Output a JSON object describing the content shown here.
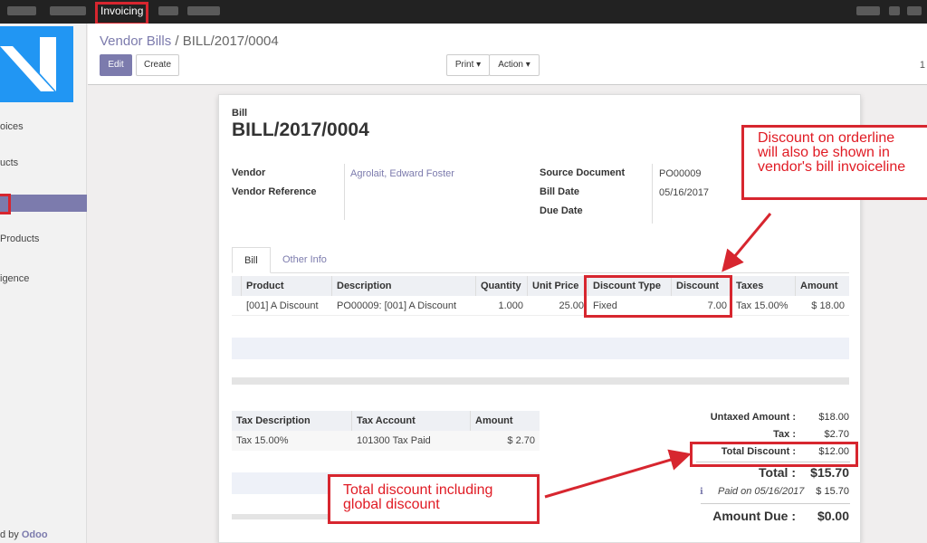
{
  "topbar": {
    "app": "Invoicing"
  },
  "sidebar": {
    "items": [
      "oices",
      "ucts",
      "Products",
      "igence"
    ],
    "powered_prefix": "d by",
    "powered_brand": "Odoo"
  },
  "breadcrumb": {
    "parent": "Vendor Bills",
    "separator": "/",
    "current": "BILL/2017/0004"
  },
  "buttons": {
    "edit": "Edit",
    "create": "Create",
    "print": "Print",
    "action": "Action"
  },
  "pager": "1",
  "bill": {
    "type_label": "Bill",
    "number": "BILL/2017/0004",
    "vendor_label": "Vendor",
    "vendor": "Agrolait, Edward Foster",
    "vendor_ref_label": "Vendor Reference",
    "source_label": "Source Document",
    "source": "PO00009",
    "bill_date_label": "Bill Date",
    "bill_date": "05/16/2017",
    "due_date_label": "Due Date"
  },
  "tabs": [
    "Bill",
    "Other Info"
  ],
  "lines": {
    "headers": [
      "Product",
      "Description",
      "Quantity",
      "Unit Price",
      "Discount Type",
      "Discount",
      "Taxes",
      "Amount"
    ],
    "row": [
      "[001] A Discount",
      "PO00009: [001] A Discount",
      "1.000",
      "25.00",
      "Fixed",
      "7.00",
      "Tax 15.00%",
      "$ 18.00"
    ]
  },
  "tax_table": {
    "headers": [
      "Tax Description",
      "Tax Account",
      "Amount"
    ],
    "row": [
      "Tax 15.00%",
      "101300 Tax Paid",
      "$ 2.70"
    ]
  },
  "totals": {
    "untaxed_label": "Untaxed Amount :",
    "untaxed": "$18.00",
    "tax_label": "Tax :",
    "tax": "$2.70",
    "discount_label": "Total Discount :",
    "discount": "$12.00",
    "total_label": "Total :",
    "total": "$15.70",
    "paid_label": "Paid on 05/16/2017",
    "paid": "$ 15.70",
    "due_label": "Amount Due :",
    "due": "$0.00"
  },
  "callouts": {
    "orderline": [
      "Discount on orderline",
      "will also be  shown in",
      "vendor's bill invoiceline"
    ],
    "total": [
      "Total discount including",
      "global discount"
    ]
  },
  "colors": {
    "accent": "#7c7bad",
    "annotation": "#d7262f"
  }
}
